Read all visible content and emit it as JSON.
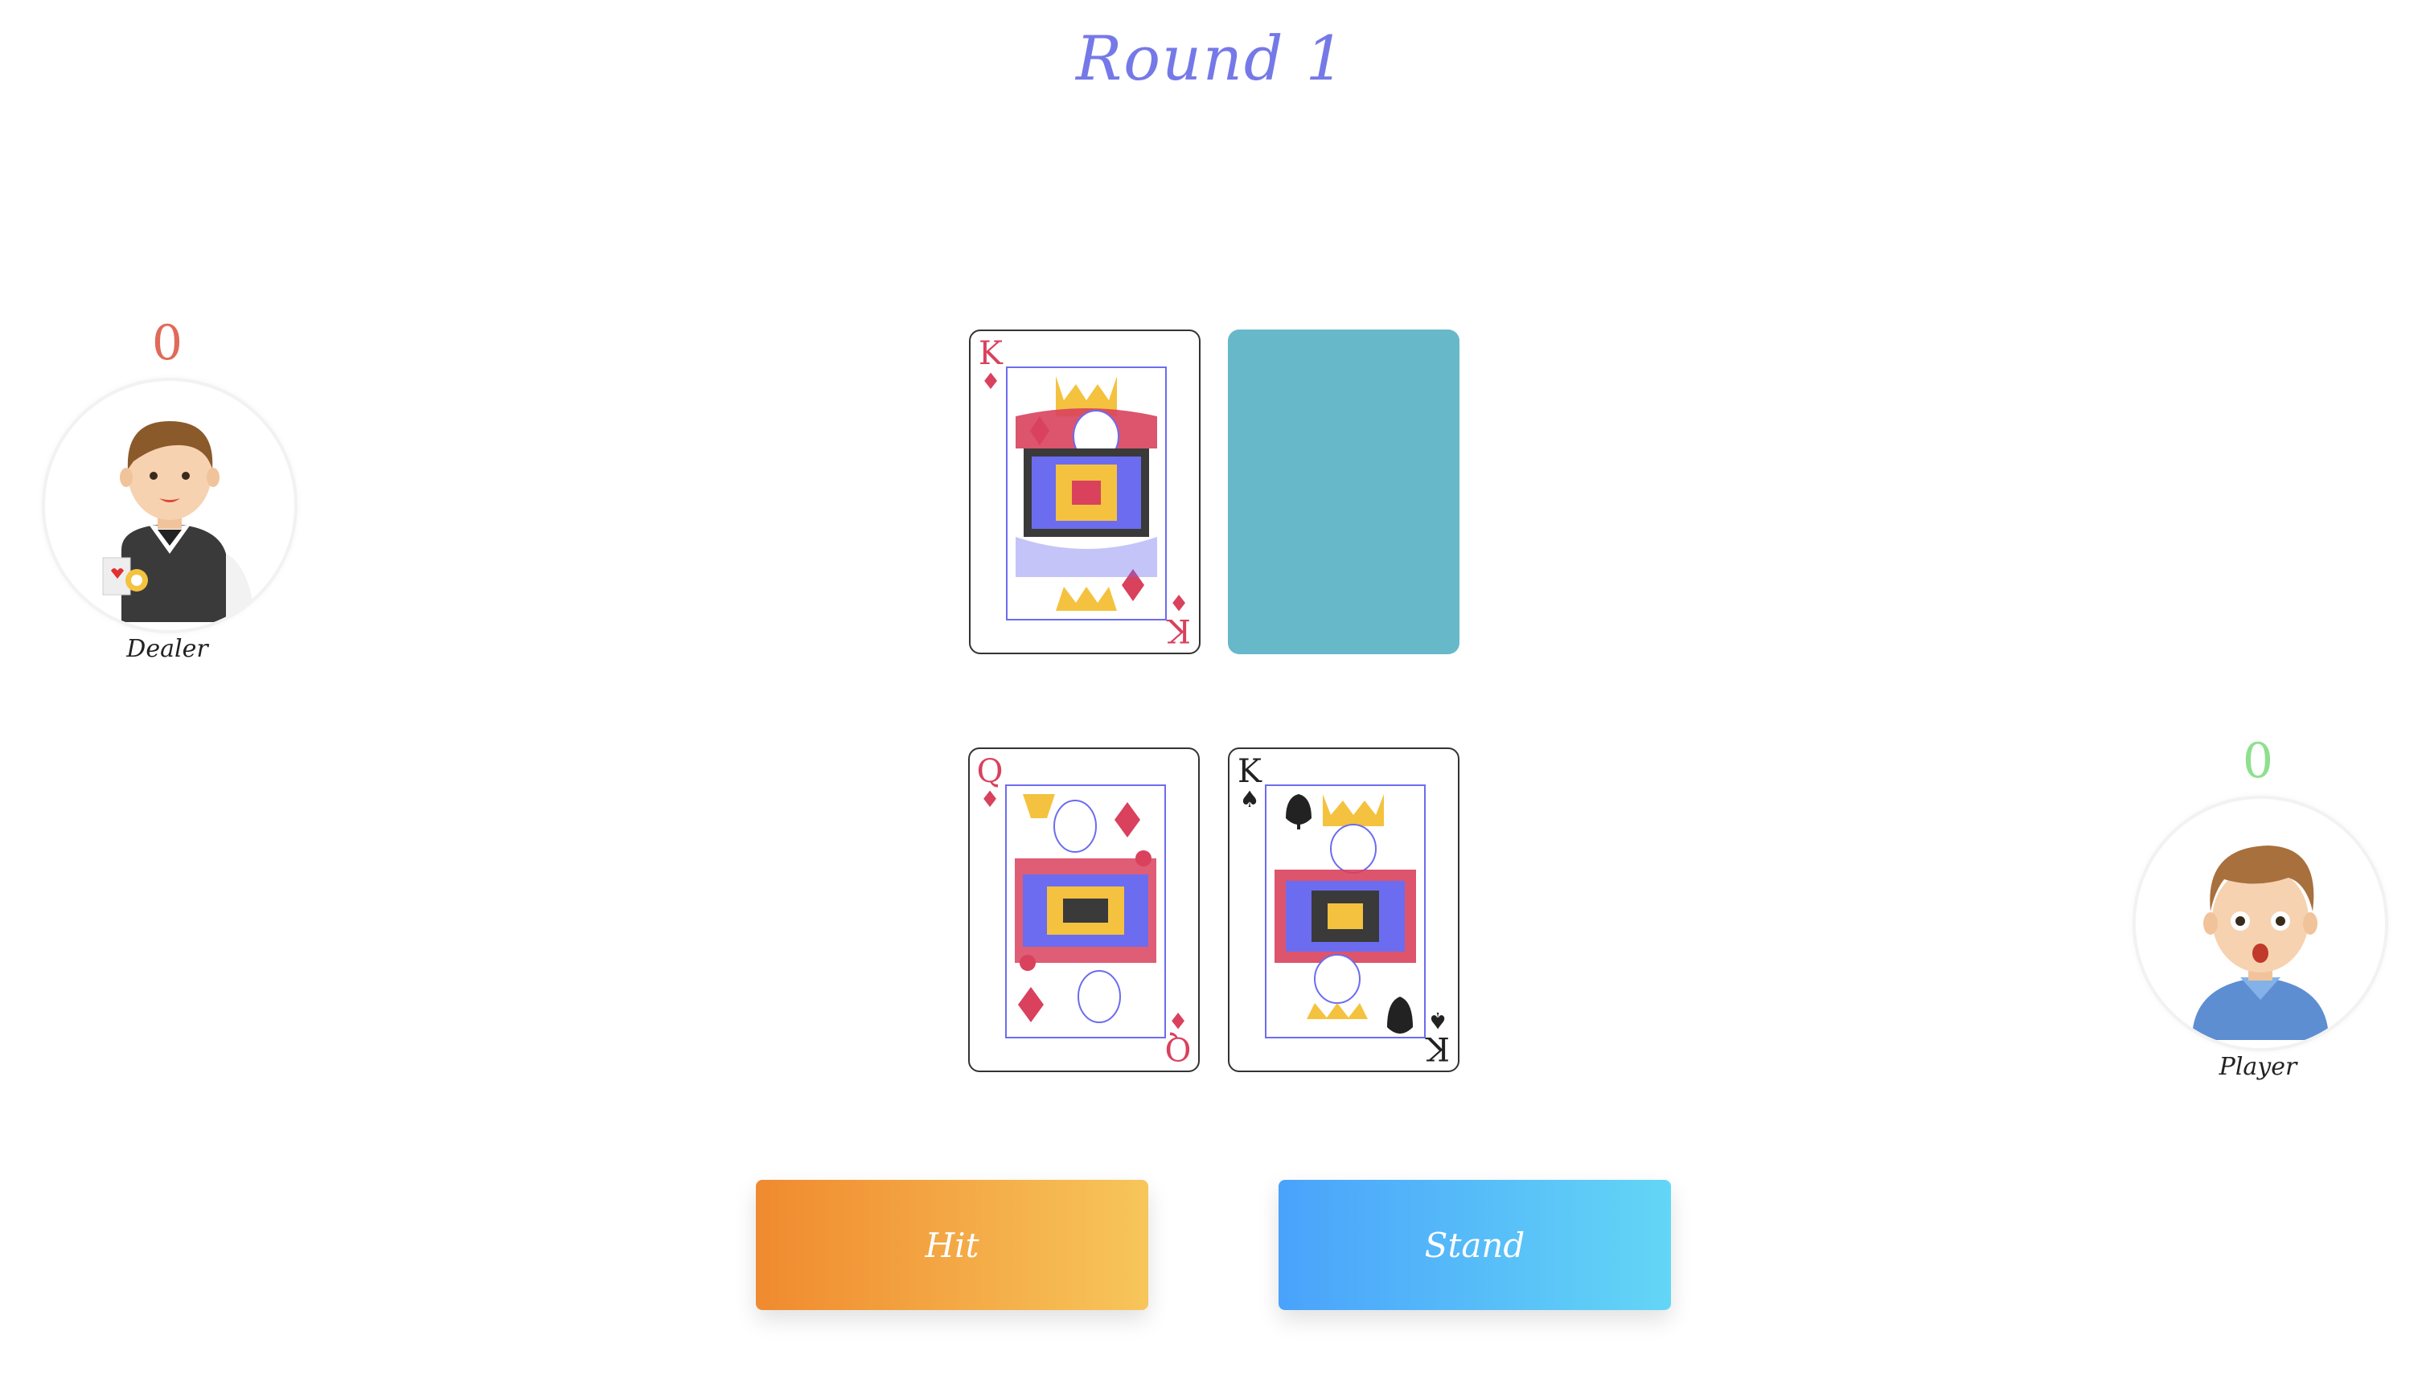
{
  "title": "Round 1",
  "dealer": {
    "score": "0",
    "name": "Dealer",
    "score_color": "#e06a5a",
    "cards": [
      {
        "rank": "K",
        "suit": "♦",
        "color": "#d9415d",
        "face": "king-of-diamonds"
      },
      {
        "hidden": true,
        "back_color": "#67b8c9"
      }
    ]
  },
  "player": {
    "score": "0",
    "name": "Player",
    "score_color": "#8ee08e",
    "cards": [
      {
        "rank": "Q",
        "suit": "♦",
        "color": "#d9415d",
        "face": "queen-of-diamonds"
      },
      {
        "rank": "K",
        "suit": "♠",
        "color": "#222222",
        "face": "king-of-spades"
      }
    ]
  },
  "controls": {
    "hit_label": "Hit",
    "stand_label": "Stand"
  }
}
